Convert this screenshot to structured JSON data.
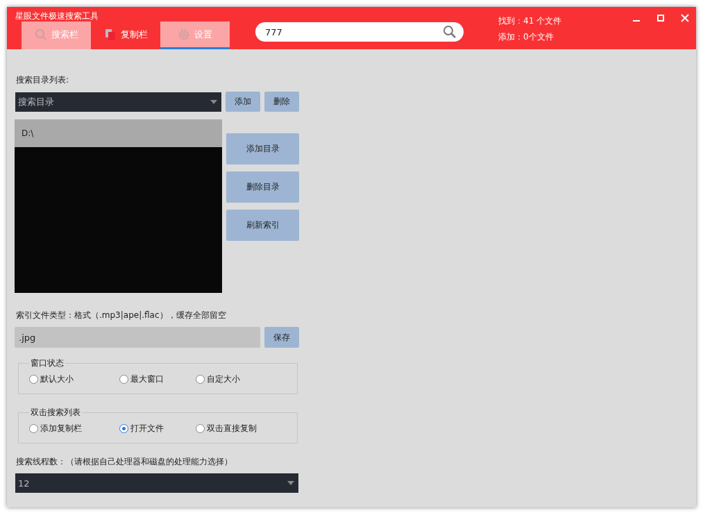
{
  "window": {
    "title": "星眼文件极速搜索工具"
  },
  "tabs": [
    {
      "label": "搜索栏",
      "kind": "search",
      "highlighted": true,
      "selected": false
    },
    {
      "label": "复制栏",
      "kind": "copy",
      "highlighted": false,
      "selected": false
    },
    {
      "label": "设置",
      "kind": "gear",
      "highlighted": true,
      "selected": true
    }
  ],
  "search": {
    "value": "777"
  },
  "stats": [
    "找到：41 个文件",
    "添加：0个文件"
  ],
  "directory": {
    "label": "搜索目录列表:",
    "dropdown": "搜索目录",
    "buttons": [
      "添加",
      "删除"
    ],
    "items": [
      {
        "text": "D:\\",
        "selected": true
      }
    ],
    "side_buttons": [
      "添加目录",
      "删除目录",
      "刷新索引"
    ]
  },
  "file_types": {
    "label": "索引文件类型：格式（.mp3|ape|.flac），缓存全部留空",
    "value": ".jpg",
    "button": "保存"
  },
  "groups": [
    {
      "title": "窗口状态",
      "options": [
        {
          "label": "默认大小",
          "selected": false
        },
        {
          "label": "最大窗口",
          "selected": false
        },
        {
          "label": "自定大小",
          "selected": false
        }
      ]
    },
    {
      "title": "双击搜索列表",
      "options": [
        {
          "label": "添加复制栏",
          "selected": false
        },
        {
          "label": "打开文件",
          "selected": true
        },
        {
          "label": "双击直接复制",
          "selected": false
        }
      ]
    }
  ],
  "threads": {
    "label": "搜索线程数：（请根据自己处理器和磁盘的处理能力选择）",
    "value": "12"
  }
}
